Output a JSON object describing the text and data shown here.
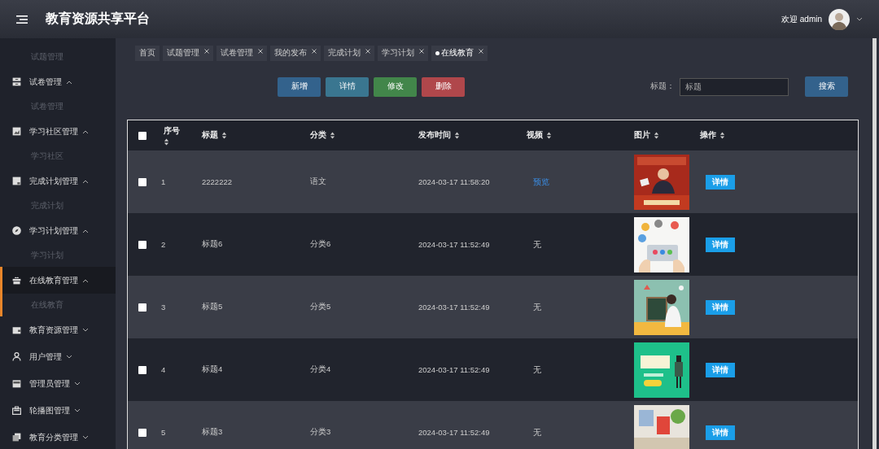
{
  "header": {
    "title": "教育资源共享平台",
    "welcome": "欢迎 admin"
  },
  "sidebar": {
    "items": [
      {
        "kind": "sub",
        "label": "试题管理"
      },
      {
        "kind": "group",
        "label": "试卷管理",
        "expanded": true,
        "selected": false,
        "children": [
          {
            "label": "试卷管理"
          }
        ]
      },
      {
        "kind": "group",
        "label": "学习社区管理",
        "expanded": true,
        "selected": false,
        "children": [
          {
            "label": "学习社区"
          }
        ]
      },
      {
        "kind": "group",
        "label": "完成计划管理",
        "expanded": true,
        "selected": false,
        "children": [
          {
            "label": "完成计划"
          }
        ]
      },
      {
        "kind": "group",
        "label": "学习计划管理",
        "expanded": true,
        "selected": false,
        "children": [
          {
            "label": "学习计划"
          }
        ]
      },
      {
        "kind": "group",
        "label": "在线教育管理",
        "expanded": true,
        "selected": true,
        "children": [
          {
            "label": "在线教育"
          }
        ]
      },
      {
        "kind": "group",
        "label": "教育资源管理",
        "expanded": false,
        "selected": false
      },
      {
        "kind": "group",
        "label": "用户管理",
        "expanded": false,
        "selected": false
      },
      {
        "kind": "group",
        "label": "管理员管理",
        "expanded": false,
        "selected": false
      },
      {
        "kind": "group",
        "label": "轮播图管理",
        "expanded": false,
        "selected": false
      },
      {
        "kind": "group",
        "label": "教育分类管理",
        "expanded": false,
        "selected": false
      }
    ]
  },
  "tabs": [
    {
      "label": "首页",
      "closable": false,
      "selected": false
    },
    {
      "label": "试题管理",
      "closable": true,
      "selected": false
    },
    {
      "label": "试卷管理",
      "closable": true,
      "selected": false
    },
    {
      "label": "我的发布",
      "closable": true,
      "selected": false
    },
    {
      "label": "完成计划",
      "closable": true,
      "selected": false
    },
    {
      "label": "学习计划",
      "closable": true,
      "selected": false
    },
    {
      "label": "在线教育",
      "closable": true,
      "selected": true
    }
  ],
  "toolbar": {
    "buttons": [
      {
        "label": "新增",
        "kind": "add"
      },
      {
        "label": "详情",
        "kind": "info"
      },
      {
        "label": "修改",
        "kind": "edit"
      },
      {
        "label": "删除",
        "kind": "delete"
      }
    ]
  },
  "search": {
    "label": "标题：",
    "placeholder": "标题",
    "button": "搜索"
  },
  "table": {
    "select_all": {
      "checked": false
    },
    "columns": [
      {
        "label": "序号"
      },
      {
        "label": "标题"
      },
      {
        "label": "分类"
      },
      {
        "label": "发布时间"
      },
      {
        "label": "视频"
      },
      {
        "label": "图片"
      },
      {
        "label": "操作"
      }
    ],
    "rows": [
      {
        "checked": false,
        "index": "1",
        "title": "2222222",
        "category": "语文",
        "time": "2024-03-17 11:58:20",
        "video": {
          "kind": "link",
          "text": "预览"
        },
        "action": "详情"
      },
      {
        "checked": false,
        "index": "2",
        "title": "标题6",
        "category": "分类6",
        "time": "2024-03-17 11:52:49",
        "video": {
          "kind": "text",
          "text": "无"
        },
        "action": "详情"
      },
      {
        "checked": false,
        "index": "3",
        "title": "标题5",
        "category": "分类5",
        "time": "2024-03-17 11:52:49",
        "video": {
          "kind": "text",
          "text": "无"
        },
        "action": "详情"
      },
      {
        "checked": false,
        "index": "4",
        "title": "标题4",
        "category": "分类4",
        "time": "2024-03-17 11:52:49",
        "video": {
          "kind": "text",
          "text": "无"
        },
        "action": "详情"
      },
      {
        "checked": false,
        "index": "5",
        "title": "标题3",
        "category": "分类3",
        "time": "2024-03-17 11:52:49",
        "video": {
          "kind": "text",
          "text": "无"
        },
        "action": "详情"
      }
    ]
  }
}
